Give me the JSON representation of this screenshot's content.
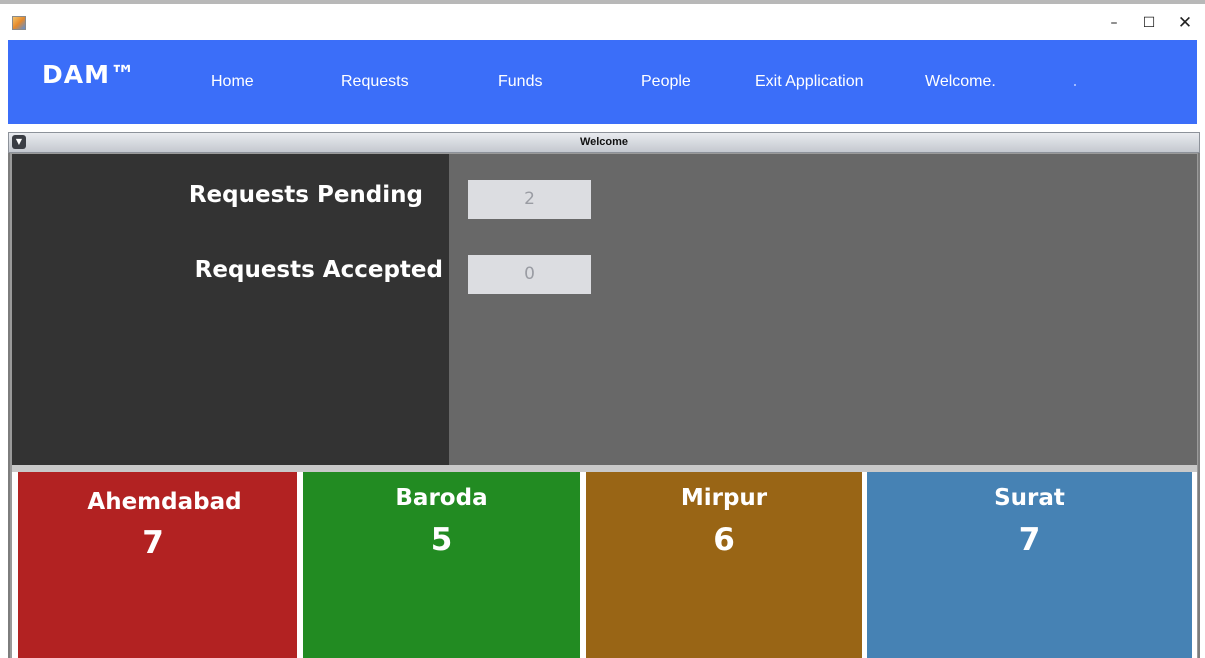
{
  "window": {
    "controls": {
      "minimize": "–",
      "maximize": "☐",
      "close": "✕"
    }
  },
  "nav": {
    "brand": "DAM™",
    "items": [
      "Home",
      "Requests",
      "Funds",
      "People",
      "Exit Application",
      "Welcome."
    ]
  },
  "frame": {
    "title": "Welcome"
  },
  "stats": {
    "pending_label": "Requests Pending",
    "pending_value": "2",
    "accepted_label": "Requests Accepted",
    "accepted_value": "0"
  },
  "cities": [
    {
      "name": "Ahemdabad",
      "count": "7",
      "color": "#b22222"
    },
    {
      "name": "Baroda",
      "count": "5",
      "color": "#228b22"
    },
    {
      "name": "Mirpur",
      "count": "6",
      "color": "#996515"
    },
    {
      "name": "Surat",
      "count": "7",
      "color": "#4682b4"
    }
  ],
  "colors": {
    "navbar": "#3b6ef9",
    "panel_dark": "#333333",
    "panel_mid": "#686868"
  }
}
